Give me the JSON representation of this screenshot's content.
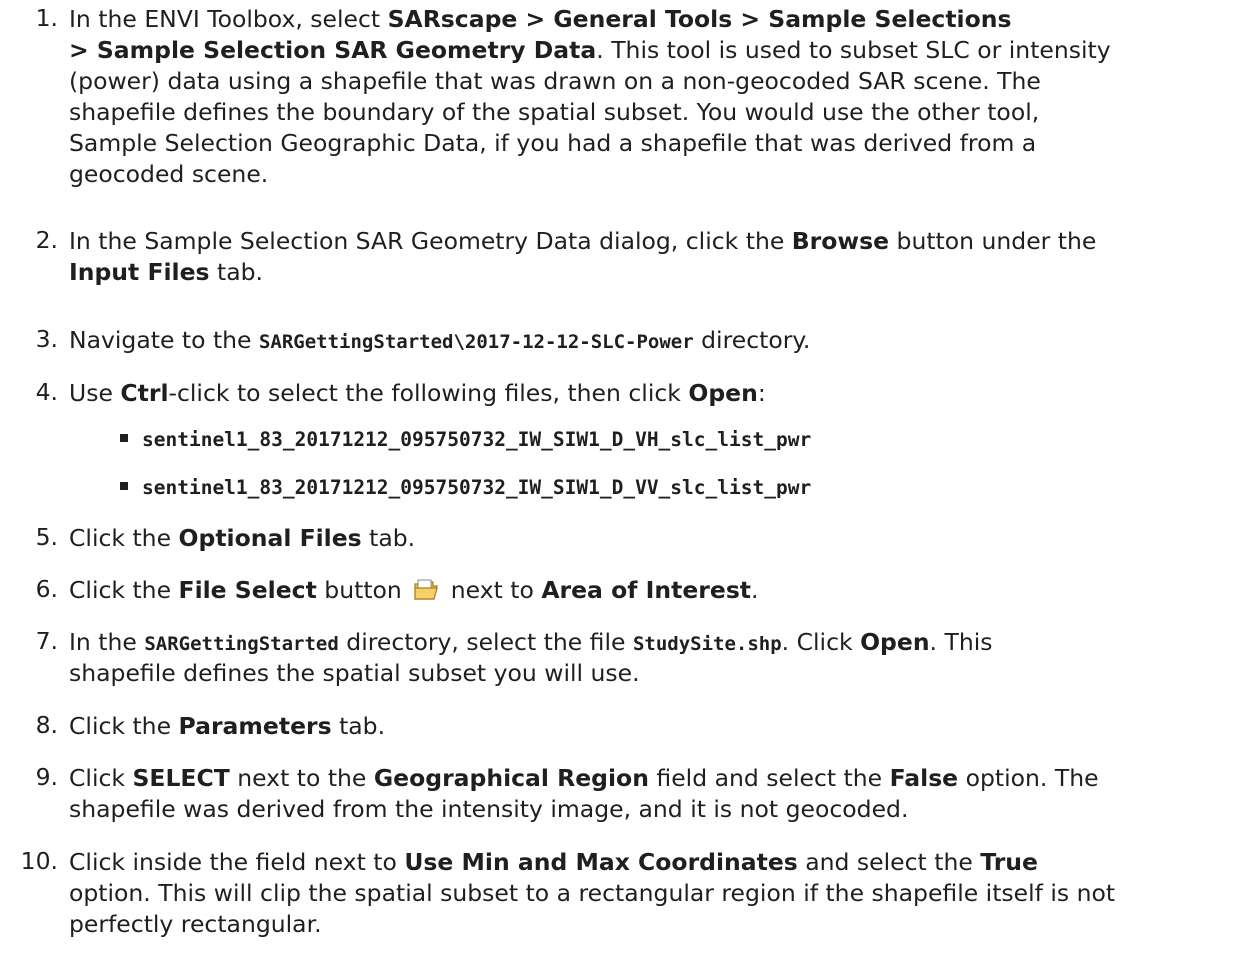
{
  "steps": [
    {
      "num": "1.",
      "l1_a": "In the ENVI Toolbox, select ",
      "l1_b": "SARscape > General Tools > Sample Selections",
      "l2_a": "> Sample Selection SAR Geometry Data",
      "l2_b": ". This tool is used to subset SLC or intensity",
      "l3": "(power) data using a shapefile that was drawn on a non-geocoded SAR scene. The",
      "l4": "shapefile defines the boundary of the spatial subset. You would use the other tool,",
      "l5": "Sample Selection Geographic Data, if you had a shapefile that was derived from a",
      "l6": "geocoded scene."
    },
    {
      "num": "2.",
      "l1_a": "In the Sample Selection SAR Geometry Data dialog, click the ",
      "l1_b": "Browse",
      "l1_c": " button under the",
      "l2_a": "Input Files",
      "l2_b": " tab."
    },
    {
      "num": "3.",
      "l1_a": "Navigate to the ",
      "l1_b": "SARGettingStarted\\2017-12-12-SLC-Power",
      "l1_c": " directory."
    },
    {
      "num": "4.",
      "l1_a": "Use ",
      "l1_b": "Ctrl",
      "l1_c": "-click to select the following files, then click ",
      "l1_d": "Open",
      "l1_e": ":",
      "files": [
        "sentinel1_83_20171212_095750732_IW_SIW1_D_VH_slc_list_pwr",
        "sentinel1_83_20171212_095750732_IW_SIW1_D_VV_slc_list_pwr"
      ]
    },
    {
      "num": "5.",
      "l1_a": "Click the ",
      "l1_b": "Optional Files",
      "l1_c": " tab."
    },
    {
      "num": "6.",
      "l1_a": "Click the ",
      "l1_b": "File Select",
      "l1_c": " button ",
      "l1_d": " next to ",
      "l1_e": "Area of Interest",
      "l1_f": "."
    },
    {
      "num": "7.",
      "l1_a": "In the ",
      "l1_b": "SARGettingStarted",
      "l1_c": " directory, select the file ",
      "l1_d": "StudySite.shp",
      "l1_e": ". Click ",
      "l1_f": "Open",
      "l1_g": ". This",
      "l2": "shapefile defines the spatial subset you will use."
    },
    {
      "num": "8.",
      "l1_a": "Click the ",
      "l1_b": "Parameters",
      "l1_c": " tab."
    },
    {
      "num": "9.",
      "l1_a": "Click ",
      "l1_b": "SELECT",
      "l1_c": " next to the ",
      "l1_d": "Geographical Region",
      "l1_e": " field and select the ",
      "l1_f": "False",
      "l1_g": " option. The",
      "l2": "shapefile was derived from the intensity image, and it is not geocoded."
    },
    {
      "num": "10.",
      "l1_a": "Click inside the field next to ",
      "l1_b": "Use Min and Max Coordinates",
      "l1_c": " and select the ",
      "l1_d": "True",
      "l2": "option. This will clip the spatial subset to a rectangular region if the shapefile itself is not",
      "l3": "perfectly rectangular."
    }
  ],
  "icons": {
    "file_select": "folder-open-icon",
    "color": "#e8b84a"
  }
}
